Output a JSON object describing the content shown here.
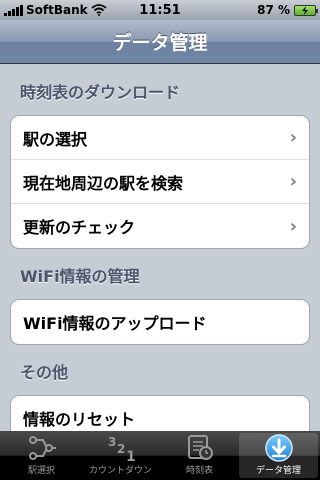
{
  "status_bar": {
    "carrier": "SoftBank",
    "time": "11:51",
    "battery_percent": "87 %",
    "wifi_icon": "wifi-icon",
    "battery_icon": "battery-icon"
  },
  "nav": {
    "title": "データ管理"
  },
  "sections": [
    {
      "header": "時刻表のダウンロード",
      "rows": [
        {
          "label": "駅の選択",
          "chevron": true
        },
        {
          "label": "現在地周辺の駅を検索",
          "chevron": true
        },
        {
          "label": "更新のチェック",
          "chevron": true
        }
      ]
    },
    {
      "header": "WiFi情報の管理",
      "rows": [
        {
          "label": "WiFi情報のアップロード",
          "chevron": false
        }
      ]
    },
    {
      "header": "その他",
      "rows": [
        {
          "label": "情報のリセット",
          "chevron": false
        }
      ]
    }
  ],
  "tabs": [
    {
      "label": "駅選択",
      "icon": "station-select-icon",
      "active": false
    },
    {
      "label": "カウントダウン",
      "icon": "countdown-icon",
      "active": false
    },
    {
      "label": "時刻表",
      "icon": "timetable-icon",
      "active": false
    },
    {
      "label": "データ管理",
      "icon": "download-icon",
      "active": true
    }
  ],
  "chevron_glyph": "›",
  "colors": {
    "accent": "#6d84a2",
    "background": "#c5ccd4",
    "section_header": "#4c566c"
  }
}
